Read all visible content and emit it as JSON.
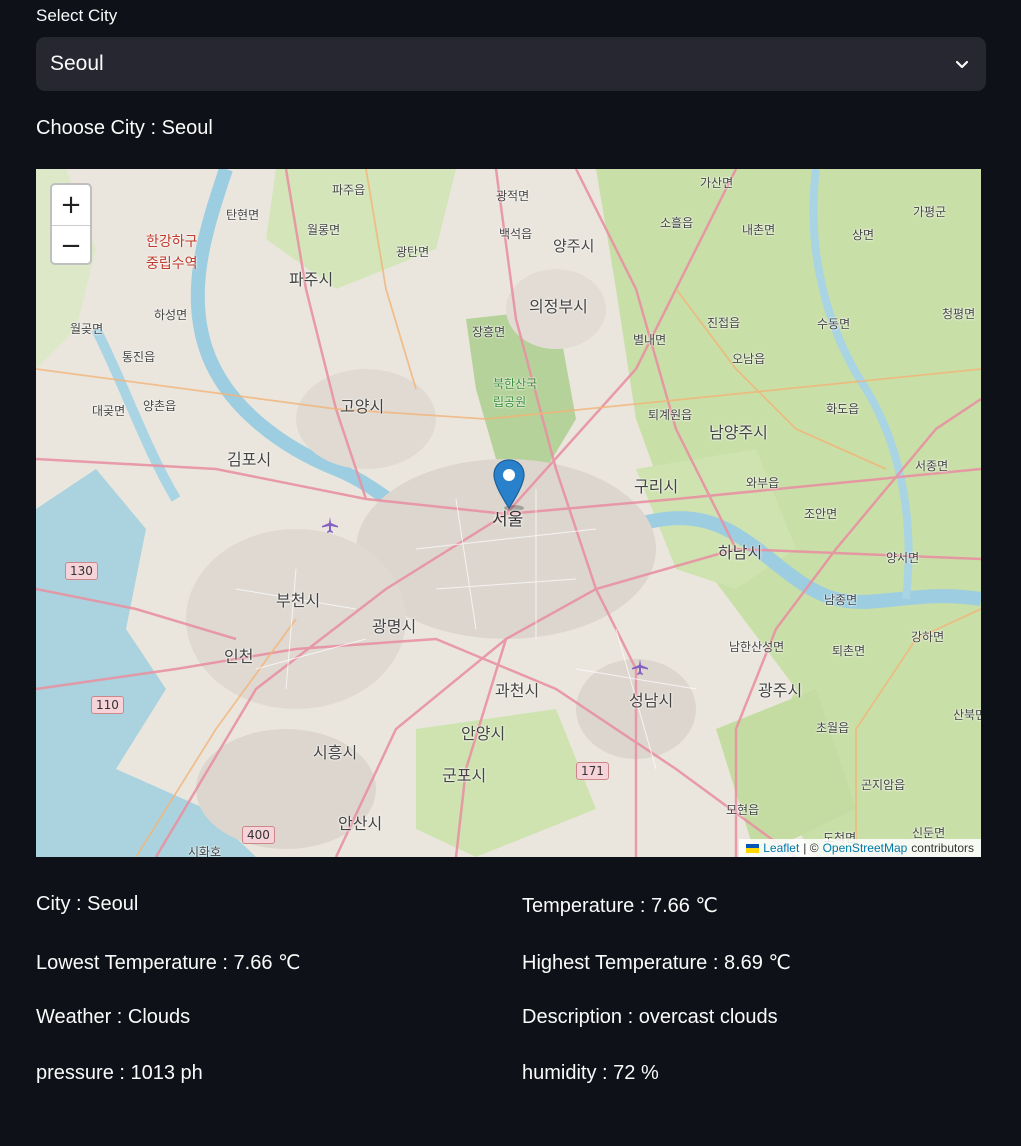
{
  "select": {
    "label": "Select City",
    "value": "Seoul"
  },
  "choose_text": "Choose City : Seoul",
  "map": {
    "zoom_in": "+",
    "zoom_out": "−",
    "marker_label": "서울",
    "attribution": {
      "leaflet": "Leaflet",
      "separator": " | © ",
      "osm": "OpenStreetMap",
      "suffix": " contributors"
    },
    "place_labels": [
      "파주읍",
      "광적면",
      "가산면",
      "탄현면",
      "월롱면",
      "백석읍",
      "양주시",
      "소흘읍",
      "내촌면",
      "상면",
      "가평군",
      "한강하구",
      "중립수역",
      "광탄면",
      "파주시",
      "의정부시",
      "하성면",
      "장흥면",
      "진접읍",
      "수동면",
      "청평면",
      "월곶면",
      "별내면",
      "통진읍",
      "오남읍",
      "북한산국",
      "립공원",
      "대곶면",
      "양촌읍",
      "고양시",
      "퇴계원읍",
      "화도읍",
      "남양주시",
      "김포시",
      "구리시",
      "와부읍",
      "서종면",
      "조안면",
      "하남시",
      "양서면",
      "부천시",
      "남종면",
      "광명시",
      "인천",
      "남한산성면",
      "퇴촌면",
      "강하면",
      "과천시",
      "광주시",
      "성남시",
      "산북면",
      "안양시",
      "초월읍",
      "시흥시",
      "군포시",
      "곤지암읍",
      "모현읍",
      "안산시",
      "시화호",
      "도척면",
      "신둔면"
    ],
    "route_shields": [
      "130",
      "110",
      "400",
      "171"
    ]
  },
  "info": {
    "city": "City : Seoul",
    "temperature": "Temperature : 7.66 ℃",
    "lowest": "Lowest Temperature : 7.66 ℃",
    "highest": "Highest Temperature : 8.69 ℃",
    "weather": "Weather : Clouds",
    "description": "Description : overcast clouds",
    "pressure": "pressure : 1013 ph",
    "humidity": "humidity : 72 %"
  },
  "colors": {
    "background": "#0e1117",
    "select_bg": "#262730",
    "text": "#fafafa",
    "marker": "#2a81cb",
    "link": "#0078a8"
  }
}
